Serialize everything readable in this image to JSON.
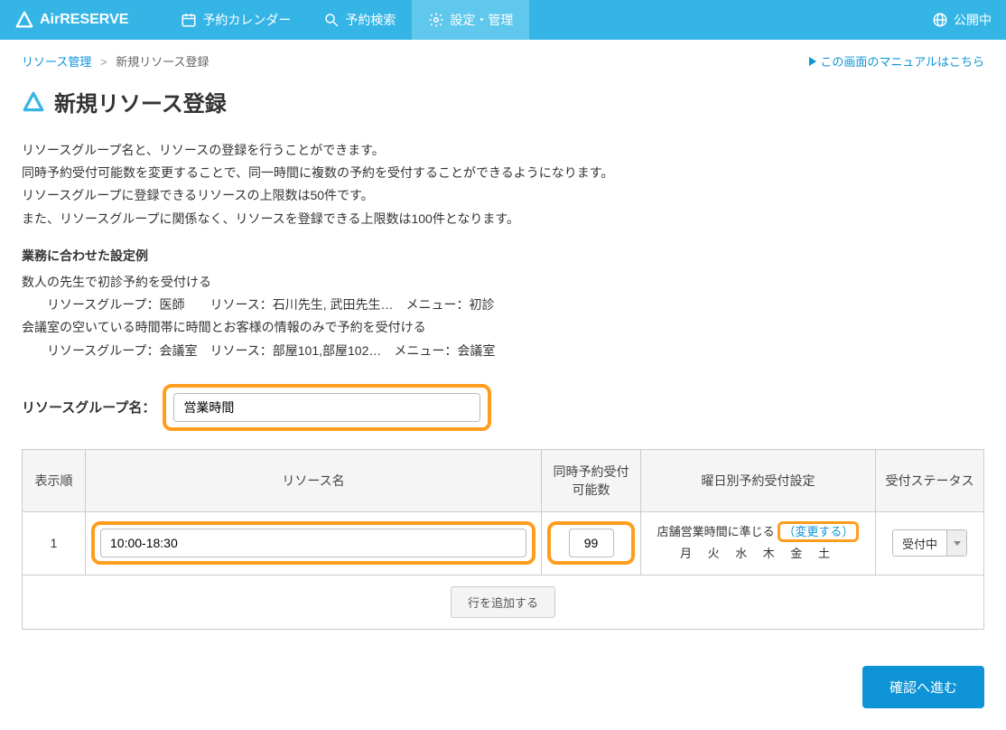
{
  "brand": "AirRESERVE",
  "nav": {
    "calendar": "予約カレンダー",
    "search": "予約検索",
    "settings": "設定・管理"
  },
  "header_right": "公開中",
  "breadcrumb": {
    "parent": "リソース管理",
    "current": "新規リソース登録"
  },
  "manual_link": "この画面のマニュアルはこちら",
  "page_title": "新規リソース登録",
  "description": {
    "line1": "リソースグループ名と、リソースの登録を行うことができます。",
    "line2": "同時予約受付可能数を変更することで、同一時間に複数の予約を受付することができるようになります。",
    "line3": "リソースグループに登録できるリソースの上限数は50件です。",
    "line4": "また、リソースグループに関係なく、リソースを登録できる上限数は100件となります。"
  },
  "examples": {
    "title": "業務に合わせた設定例",
    "ex1": "数人の先生で初診予約を受付ける",
    "ex1_detail": "リソースグループ：医師　　リソース：石川先生, 武田先生…　メニュー：初診",
    "ex2": "会議室の空いている時間帯に時間とお客様の情報のみで予約を受付ける",
    "ex2_detail": "リソースグループ：会議室　リソース：部屋101,部屋102…　メニュー：会議室"
  },
  "group_name_label": "リソースグループ名：",
  "group_name_value": "営業時間",
  "table": {
    "headers": {
      "order": "表示順",
      "name": "リソース名",
      "capacity": "同時予約受付\n可能数",
      "weekday": "曜日別予約受付設定",
      "status": "受付ステータス"
    },
    "rows": [
      {
        "order": "1",
        "name": "10:00-18:30",
        "capacity": "99",
        "weekday_note": "店舗営業時間に準じる",
        "change_label": "（変更する）",
        "weekdays": "月 火 水 木 金 土",
        "status": "受付中"
      }
    ],
    "add_row_label": "行を追加する"
  },
  "submit_label": "確認へ進む"
}
